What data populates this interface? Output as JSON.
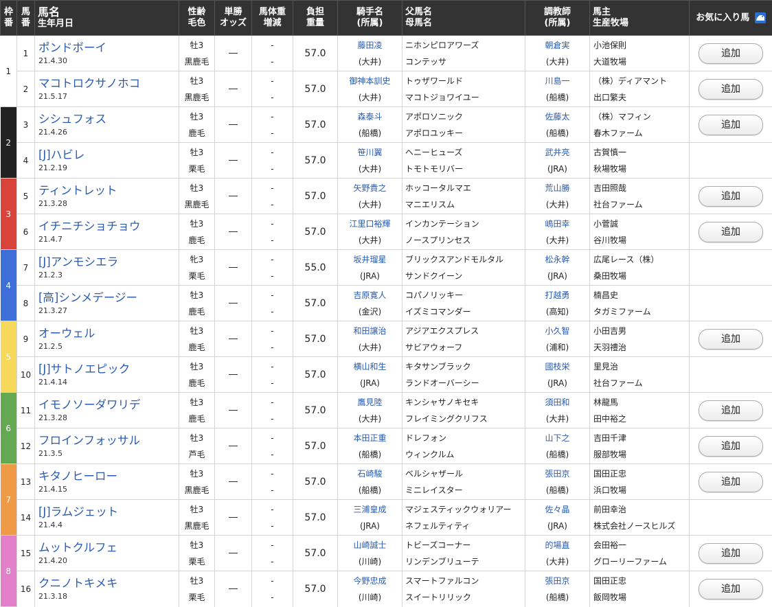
{
  "header": {
    "waku": [
      "枠",
      "番"
    ],
    "umaban": [
      "馬",
      "番"
    ],
    "name": [
      "馬名",
      "生年月日"
    ],
    "sexage": [
      "性齢",
      "毛色"
    ],
    "odds": [
      "単勝",
      "オッズ"
    ],
    "weightchg": [
      "馬体重",
      "増減"
    ],
    "futan": [
      "負担",
      "重量"
    ],
    "jockey": [
      "騎手名",
      "(所属)"
    ],
    "pedigree": [
      "父馬名",
      "母馬名"
    ],
    "trainer": [
      "調教師",
      "(所属)"
    ],
    "owner": [
      "馬主",
      "生産牧場"
    ],
    "favorite": "お気に入り馬",
    "favorite_icon": "favorite-horse-icon"
  },
  "frame_colors": {
    "1": "#ffffff",
    "2": "#222222",
    "3": "#d9443a",
    "4": "#3e6fd8",
    "5": "#f6d85a",
    "6": "#64a852",
    "7": "#ee9a47",
    "8": "#e17fc8"
  },
  "add_label": "追加",
  "horses": [
    {
      "waku": "1",
      "uma": "1",
      "name": "ポンドボーイ",
      "birth": "21.4.30",
      "sex": "牡3",
      "coat": "黒鹿毛",
      "odds": "―",
      "wt1": "-",
      "wt2": "-",
      "futan": "57.0",
      "jockey": "藤田凌",
      "jaff": "(大井)",
      "sire": "ニホンピロアワーズ",
      "dam": "コンテッサ",
      "trainer": "朝倉実",
      "taff": "(大井)",
      "owner": "小池保則",
      "breeder": "大道牧場",
      "fav": true
    },
    {
      "waku": "1",
      "uma": "2",
      "name": "マコトロクサノホコ",
      "birth": "21.5.17",
      "sex": "牡3",
      "coat": "黒鹿毛",
      "odds": "―",
      "wt1": "-",
      "wt2": "-",
      "futan": "57.0",
      "jockey": "御神本訓史",
      "jaff": "(大井)",
      "sire": "トゥザワールド",
      "dam": "マコトジョワイユー",
      "trainer": "川島一",
      "taff": "(船橋)",
      "owner": "（株）ディアマント",
      "breeder": "出口繁夫",
      "fav": true
    },
    {
      "waku": "2",
      "uma": "3",
      "name": "シシュフォス",
      "birth": "21.4.26",
      "sex": "牡3",
      "coat": "鹿毛",
      "odds": "―",
      "wt1": "-",
      "wt2": "-",
      "futan": "57.0",
      "jockey": "森泰斗",
      "jaff": "(船橋)",
      "sire": "アポロソニック",
      "dam": "アポロユッキー",
      "trainer": "佐藤太",
      "taff": "(船橋)",
      "owner": "（株）マフィン",
      "breeder": "春木ファーム",
      "fav": true
    },
    {
      "waku": "2",
      "uma": "4",
      "name": "[J]ハビレ",
      "birth": "21.2.19",
      "sex": "牡3",
      "coat": "栗毛",
      "odds": "―",
      "wt1": "-",
      "wt2": "-",
      "futan": "57.0",
      "jockey": "笹川翼",
      "jaff": "(大井)",
      "sire": "ヘニーヒューズ",
      "dam": "トモトモリバー",
      "trainer": "武井亮",
      "taff": "(JRA)",
      "owner": "古賀慎一",
      "breeder": "秋場牧場",
      "fav": false
    },
    {
      "waku": "3",
      "uma": "5",
      "name": "ティントレット",
      "birth": "21.3.28",
      "sex": "牡3",
      "coat": "黒鹿毛",
      "odds": "―",
      "wt1": "-",
      "wt2": "-",
      "futan": "57.0",
      "jockey": "矢野貴之",
      "jaff": "(大井)",
      "sire": "ホッコータルマエ",
      "dam": "マニエリスム",
      "trainer": "荒山勝",
      "taff": "(大井)",
      "owner": "吉田照哉",
      "breeder": "社台ファーム",
      "fav": true
    },
    {
      "waku": "3",
      "uma": "6",
      "name": "イチニチショチョウ",
      "birth": "21.4.7",
      "sex": "牡3",
      "coat": "鹿毛",
      "odds": "―",
      "wt1": "-",
      "wt2": "-",
      "futan": "57.0",
      "jockey": "江里口裕輝",
      "jaff": "(大井)",
      "sire": "インカンテーション",
      "dam": "ノースプリンセス",
      "trainer": "嶋田幸",
      "taff": "(大井)",
      "owner": "小菅誠",
      "breeder": "谷川牧場",
      "fav": true
    },
    {
      "waku": "4",
      "uma": "7",
      "name": "[J]アンモシエラ",
      "birth": "21.2.3",
      "sex": "牝3",
      "coat": "栗毛",
      "odds": "―",
      "wt1": "-",
      "wt2": "-",
      "futan": "55.0",
      "jockey": "坂井瑠星",
      "jaff": "(JRA)",
      "sire": "ブリックスアンドモルタル",
      "dam": "サンドクイーン",
      "trainer": "松永幹",
      "taff": "(JRA)",
      "owner": "広尾レース（株）",
      "breeder": "桑田牧場",
      "fav": false
    },
    {
      "waku": "4",
      "uma": "8",
      "name": "[高]シンメデージー",
      "birth": "21.3.27",
      "sex": "牡3",
      "coat": "鹿毛",
      "odds": "―",
      "wt1": "-",
      "wt2": "-",
      "futan": "57.0",
      "jockey": "吉原寛人",
      "jaff": "(金沢)",
      "sire": "コパノリッキー",
      "dam": "イズミコマンダー",
      "trainer": "打越勇",
      "taff": "(高知)",
      "owner": "楠昌史",
      "breeder": "タガミファーム",
      "fav": false
    },
    {
      "waku": "5",
      "uma": "9",
      "name": "オーウェル",
      "birth": "21.2.5",
      "sex": "牡3",
      "coat": "鹿毛",
      "odds": "―",
      "wt1": "-",
      "wt2": "-",
      "futan": "57.0",
      "jockey": "和田譲治",
      "jaff": "(大井)",
      "sire": "アジアエクスプレス",
      "dam": "サビアウォーフ",
      "trainer": "小久智",
      "taff": "(浦和)",
      "owner": "小田吉男",
      "breeder": "天羽禮治",
      "fav": true
    },
    {
      "waku": "5",
      "uma": "10",
      "name": "[J]サトノエピック",
      "birth": "21.4.14",
      "sex": "牡3",
      "coat": "鹿毛",
      "odds": "―",
      "wt1": "-",
      "wt2": "-",
      "futan": "57.0",
      "jockey": "横山和生",
      "jaff": "(JRA)",
      "sire": "キタサンブラック",
      "dam": "ランドオーバーシー",
      "trainer": "國枝栄",
      "taff": "(JRA)",
      "owner": "里見治",
      "breeder": "社台ファーム",
      "fav": false
    },
    {
      "waku": "6",
      "uma": "11",
      "name": "イモノソーダワリデ",
      "birth": "21.3.28",
      "sex": "牡3",
      "coat": "鹿毛",
      "odds": "―",
      "wt1": "-",
      "wt2": "-",
      "futan": "57.0",
      "jockey": "鷹見陸",
      "jaff": "(大井)",
      "sire": "キンシャサノキセキ",
      "dam": "フレイミングクリフス",
      "trainer": "須田和",
      "taff": "(大井)",
      "owner": "林龍馬",
      "breeder": "田中裕之",
      "fav": true
    },
    {
      "waku": "6",
      "uma": "12",
      "name": "フロインフォッサル",
      "birth": "21.3.5",
      "sex": "牡3",
      "coat": "芦毛",
      "odds": "―",
      "wt1": "-",
      "wt2": "-",
      "futan": "57.0",
      "jockey": "本田正重",
      "jaff": "(船橋)",
      "sire": "ドレフォン",
      "dam": "ウィンクルム",
      "trainer": "山下之",
      "taff": "(船橋)",
      "owner": "吉田千津",
      "breeder": "服部牧場",
      "fav": true
    },
    {
      "waku": "7",
      "uma": "13",
      "name": "キタノヒーロー",
      "birth": "21.4.15",
      "sex": "牡3",
      "coat": "黒鹿毛",
      "odds": "―",
      "wt1": "-",
      "wt2": "-",
      "futan": "57.0",
      "jockey": "石崎駿",
      "jaff": "(船橋)",
      "sire": "ベルシャザール",
      "dam": "ミニレイスター",
      "trainer": "張田京",
      "taff": "(船橋)",
      "owner": "国田正忠",
      "breeder": "浜口牧場",
      "fav": true
    },
    {
      "waku": "7",
      "uma": "14",
      "name": "[J]ラムジェット",
      "birth": "21.4.4",
      "sex": "牡3",
      "coat": "黒鹿毛",
      "odds": "―",
      "wt1": "-",
      "wt2": "-",
      "futan": "57.0",
      "jockey": "三浦皇成",
      "jaff": "(JRA)",
      "sire": "マジェスティックウォリアー",
      "dam": "ネフェルティティ",
      "trainer": "佐々晶",
      "taff": "(JRA)",
      "owner": "前田幸治",
      "breeder": "株式会社ノースヒルズ",
      "fav": false
    },
    {
      "waku": "8",
      "uma": "15",
      "name": "ムットクルフェ",
      "birth": "21.4.20",
      "sex": "牡3",
      "coat": "栗毛",
      "odds": "―",
      "wt1": "-",
      "wt2": "-",
      "futan": "57.0",
      "jockey": "山崎誠士",
      "jaff": "(川崎)",
      "sire": "トビーズコーナー",
      "dam": "リンデンブリューテ",
      "trainer": "的場直",
      "taff": "(大井)",
      "owner": "会田裕一",
      "breeder": "グローリーファーム",
      "fav": true
    },
    {
      "waku": "8",
      "uma": "16",
      "name": "クニノトキメキ",
      "birth": "21.3.18",
      "sex": "牡3",
      "coat": "栗毛",
      "odds": "―",
      "wt1": "-",
      "wt2": "-",
      "futan": "57.0",
      "jockey": "今野忠成",
      "jaff": "(川崎)",
      "sire": "スマートファルコン",
      "dam": "スイートリリック",
      "trainer": "張田京",
      "taff": "(船橋)",
      "owner": "国田正忠",
      "breeder": "飯岡牧場",
      "fav": true
    }
  ]
}
